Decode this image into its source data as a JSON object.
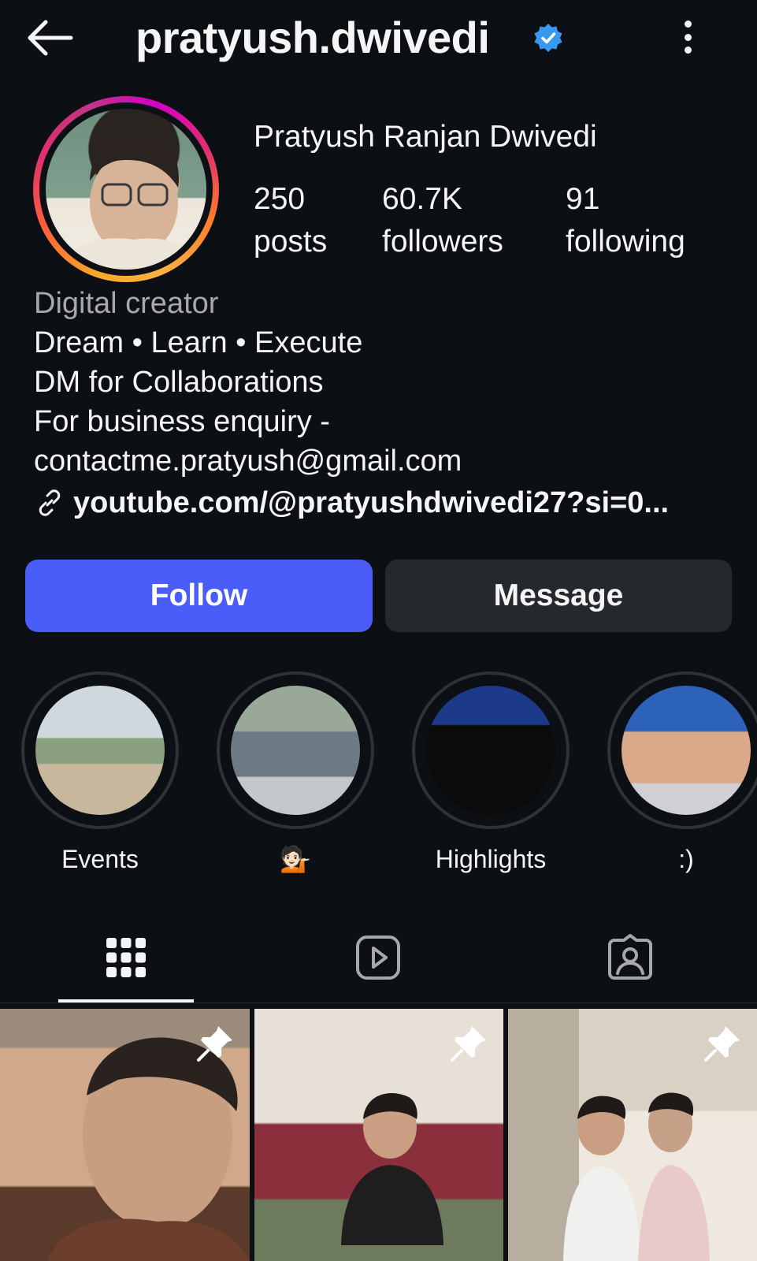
{
  "header": {
    "username": "pratyush.dwivedi",
    "back_icon": "arrow-left-icon",
    "verified_icon": "verified-badge-icon",
    "menu_icon": "more-vertical-icon"
  },
  "profile": {
    "full_name": "Pratyush Ranjan Dwivedi",
    "stats": [
      {
        "value": "250",
        "label": "posts"
      },
      {
        "value": "60.7K",
        "label": "followers"
      },
      {
        "value": "91",
        "label": "following"
      }
    ]
  },
  "bio": {
    "category": "Digital creator",
    "lines": [
      "Dream • Learn • Execute",
      "DM for Collaborations",
      "For business enquiry -",
      "contactme.pratyush@gmail.com"
    ],
    "link": "youtube.com/@pratyushdwivedi27?si=0..."
  },
  "actions": {
    "follow": "Follow",
    "message": "Message"
  },
  "highlights": [
    {
      "label": "Events"
    },
    {
      "label": "💁🏻"
    },
    {
      "label": "Highlights"
    },
    {
      "label": ":)"
    }
  ],
  "tabs": [
    {
      "icon": "grid-icon",
      "active": true
    },
    {
      "icon": "reels-icon",
      "active": false
    },
    {
      "icon": "tagged-icon",
      "active": false
    }
  ],
  "colors": {
    "background": "#0c1014",
    "follow_button": "#4a5df9",
    "message_button": "#25292e",
    "verified": "#3897f0",
    "secondary_text": "#a8a8a8"
  }
}
